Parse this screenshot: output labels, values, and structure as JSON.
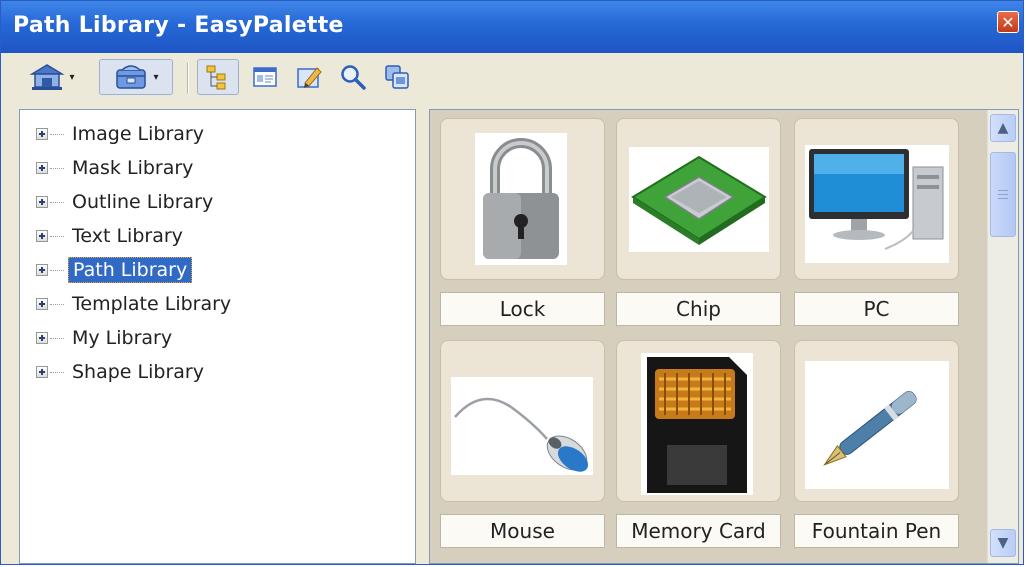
{
  "window": {
    "title": "Path Library - EasyPalette",
    "close_glyph": "✕"
  },
  "toolbar": {
    "buttons": [
      {
        "icon": "library-home-icon"
      },
      {
        "icon": "library-category-icon"
      },
      {
        "icon": "tree-view-icon"
      },
      {
        "icon": "detail-view-icon"
      },
      {
        "icon": "edit-icon"
      },
      {
        "icon": "search-icon"
      },
      {
        "icon": "copy-icon"
      }
    ],
    "dropdown_arrow": "▾"
  },
  "tree": {
    "items": [
      {
        "label": "Image Library",
        "selected": false
      },
      {
        "label": "Mask Library",
        "selected": false
      },
      {
        "label": "Outline Library",
        "selected": false
      },
      {
        "label": "Text Library",
        "selected": false
      },
      {
        "label": "Path Library",
        "selected": true
      },
      {
        "label": "Template Library",
        "selected": false
      },
      {
        "label": "My Library",
        "selected": false
      },
      {
        "label": "Shape Library",
        "selected": false
      }
    ]
  },
  "gallery": {
    "items": [
      {
        "label": "Lock",
        "icon": "padlock-icon"
      },
      {
        "label": "Chip",
        "icon": "chip-icon"
      },
      {
        "label": "PC",
        "icon": "desktop-pc-icon"
      },
      {
        "label": "Mouse",
        "icon": "mouse-icon"
      },
      {
        "label": "Memory Card",
        "icon": "memory-card-icon"
      },
      {
        "label": "Fountain Pen",
        "icon": "fountain-pen-icon"
      }
    ]
  },
  "scrollbar": {
    "up_glyph": "▲",
    "down_glyph": "▼"
  }
}
